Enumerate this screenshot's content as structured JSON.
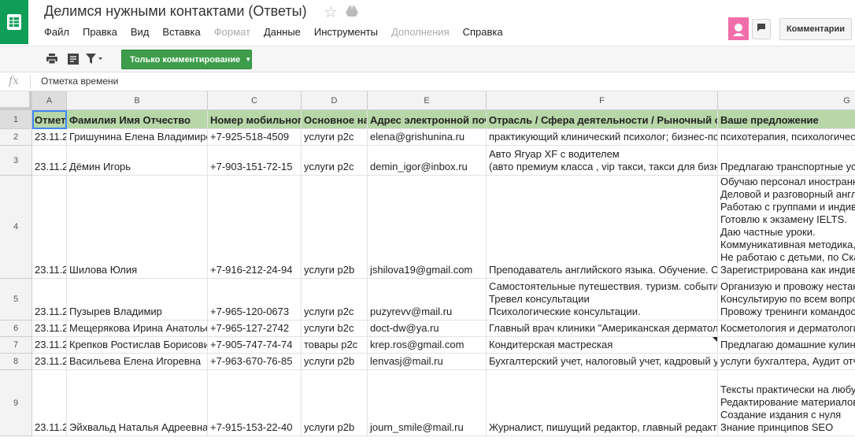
{
  "doc": {
    "title": "Делимся нужными контактами (Ответы)"
  },
  "menu": [
    "Файл",
    "Правка",
    "Вид",
    "Вставка",
    "Формат",
    "Данные",
    "Инструменты",
    "Дополнения",
    "Справка"
  ],
  "menu_disabled": [
    "Формат",
    "Дополнения"
  ],
  "header_buttons": {
    "comments_label": "Комментарии"
  },
  "toolbar": {
    "mode_label": "Только комментирование"
  },
  "formula_bar": {
    "fx_label": "fx",
    "value": "Отметка времени"
  },
  "sheet": {
    "columns": [
      "A",
      "B",
      "C",
      "D",
      "E",
      "F",
      "G"
    ],
    "selected_column": "A",
    "selected_row": "1",
    "header_row": [
      "Отметка времени",
      "Фамилия Имя Отчество",
      "Номер мобильного телефона",
      "Основное направление",
      "Адрес электронной почты",
      "Отрасль / Сфера деятельности / Рыночный сегмент",
      "Ваше предложение"
    ],
    "rows": [
      {
        "num": "2",
        "cells": [
          [
            "23.11.2"
          ],
          [
            "Гришунина Елена Владимировна"
          ],
          [
            "+7-925-518-4509"
          ],
          [
            "услуги p2c"
          ],
          [
            "elena@grishunina.ru"
          ],
          [
            "практикующий клинический психолог; бизнес-психолог"
          ],
          [
            "психотерапия, психологическое консультирование"
          ]
        ]
      },
      {
        "num": "3",
        "cells": [
          [
            "23.11.2"
          ],
          [
            "Дёмин Игорь"
          ],
          [
            "+7-903-151-72-15"
          ],
          [
            "услуги p2c"
          ],
          [
            "demin_igor@inbox.ru"
          ],
          [
            "Авто Ягуар XF с водителем",
            "(авто премиум класса , vip такси, такси для бизнеса)"
          ],
          [
            "Предлагаю транспортные услуги"
          ]
        ]
      },
      {
        "num": "4",
        "cells": [
          [
            "23.11.2"
          ],
          [
            "Шилова Юлия"
          ],
          [
            "+7-916-212-24-94"
          ],
          [
            "услуги p2b"
          ],
          [
            "jshilova19@gmail.com"
          ],
          [
            "Преподаватель английского языка. Обучение. Семинары"
          ],
          [
            "Обучаю персонал иностранному языку.",
            "Деловой и разговорный английский.",
            "Работаю с группами и индивидуально.",
            "Готовлю к экзамену IELTS.",
            "Даю частные уроки.",
            "Коммуникативная методика,",
            "Не работаю с детьми, по Скайпу.",
            "Зарегистрирована как индивидуальный предприниматель"
          ]
        ]
      },
      {
        "num": "5",
        "cells": [
          [
            "23.11.2"
          ],
          [
            "Пузырев Владимир"
          ],
          [
            "+7-965-120-0673"
          ],
          [
            "услуги p2c"
          ],
          [
            "puzyrevv@mail.ru"
          ],
          [
            "Самостоятельные путешествия. туризм. события",
            "Тревел консультации",
            "Психологические консультации."
          ],
          [
            "Организую и провожу нестандартные",
            "Консультирую по всем вопросам",
            "Провожу тренинги командообразования"
          ]
        ]
      },
      {
        "num": "6",
        "cells": [
          [
            "23.11.2"
          ],
          [
            "Мещерякова Ирина Анатольевна"
          ],
          [
            "+7-965-127-2742"
          ],
          [
            "услуги b2c"
          ],
          [
            "doct-dw@ya.ru"
          ],
          [
            "Главный врач клиники \"Американская дерматология\""
          ],
          [
            "Косметология и дерматология"
          ]
        ]
      },
      {
        "num": "7",
        "cells": [
          [
            "23.11.2"
          ],
          [
            "Крепков Ростислав Борисович"
          ],
          [
            "+7-905-747-74-74"
          ],
          [
            "товары p2c"
          ],
          [
            "krep.ros@gmail.com"
          ],
          [
            "Кондитерская мастреская"
          ],
          [
            "Предлагаю домашние кулинарные изделия"
          ]
        ]
      },
      {
        "num": "8",
        "cells": [
          [
            "23.11.2"
          ],
          [
            "Васильева Елена Игоревна"
          ],
          [
            "+7-963-670-76-85"
          ],
          [
            "услуги p2b"
          ],
          [
            "lenvasj@mail.ru"
          ],
          [
            "Бухгалтерский учет, налоговый учет, кадровый учет"
          ],
          [
            "услуги бухгалтера, Аудит отчетности"
          ]
        ]
      },
      {
        "num": "9",
        "cells": [
          [
            "23.11.2"
          ],
          [
            "Эйхвальд Наталья Адреевна"
          ],
          [
            "+7-915-153-22-40"
          ],
          [
            "услуги p2b"
          ],
          [
            "journ_smile@mail.ru"
          ],
          [
            "Журналист, пишущий редактор, главный редактор"
          ],
          [
            "Тексты практически на любую тему",
            "Редактирование материалов",
            "Создание издания с нуля",
            "Знание принципов SEO"
          ]
        ]
      }
    ]
  },
  "colors": {
    "brand_green": "#0f9d58",
    "button_green": "#3d9d4b",
    "header_row_fill": "#b7d7a8",
    "selection_blue": "#4285f4",
    "avatar_pink": "#f06eaa"
  },
  "icons": [
    "sheets-logo-icon",
    "star-icon",
    "move-to-drive-icon",
    "avatar-icon",
    "chat-icon",
    "print-icon",
    "format-icon",
    "filter-icon",
    "dropdown-arrow-icon"
  ]
}
